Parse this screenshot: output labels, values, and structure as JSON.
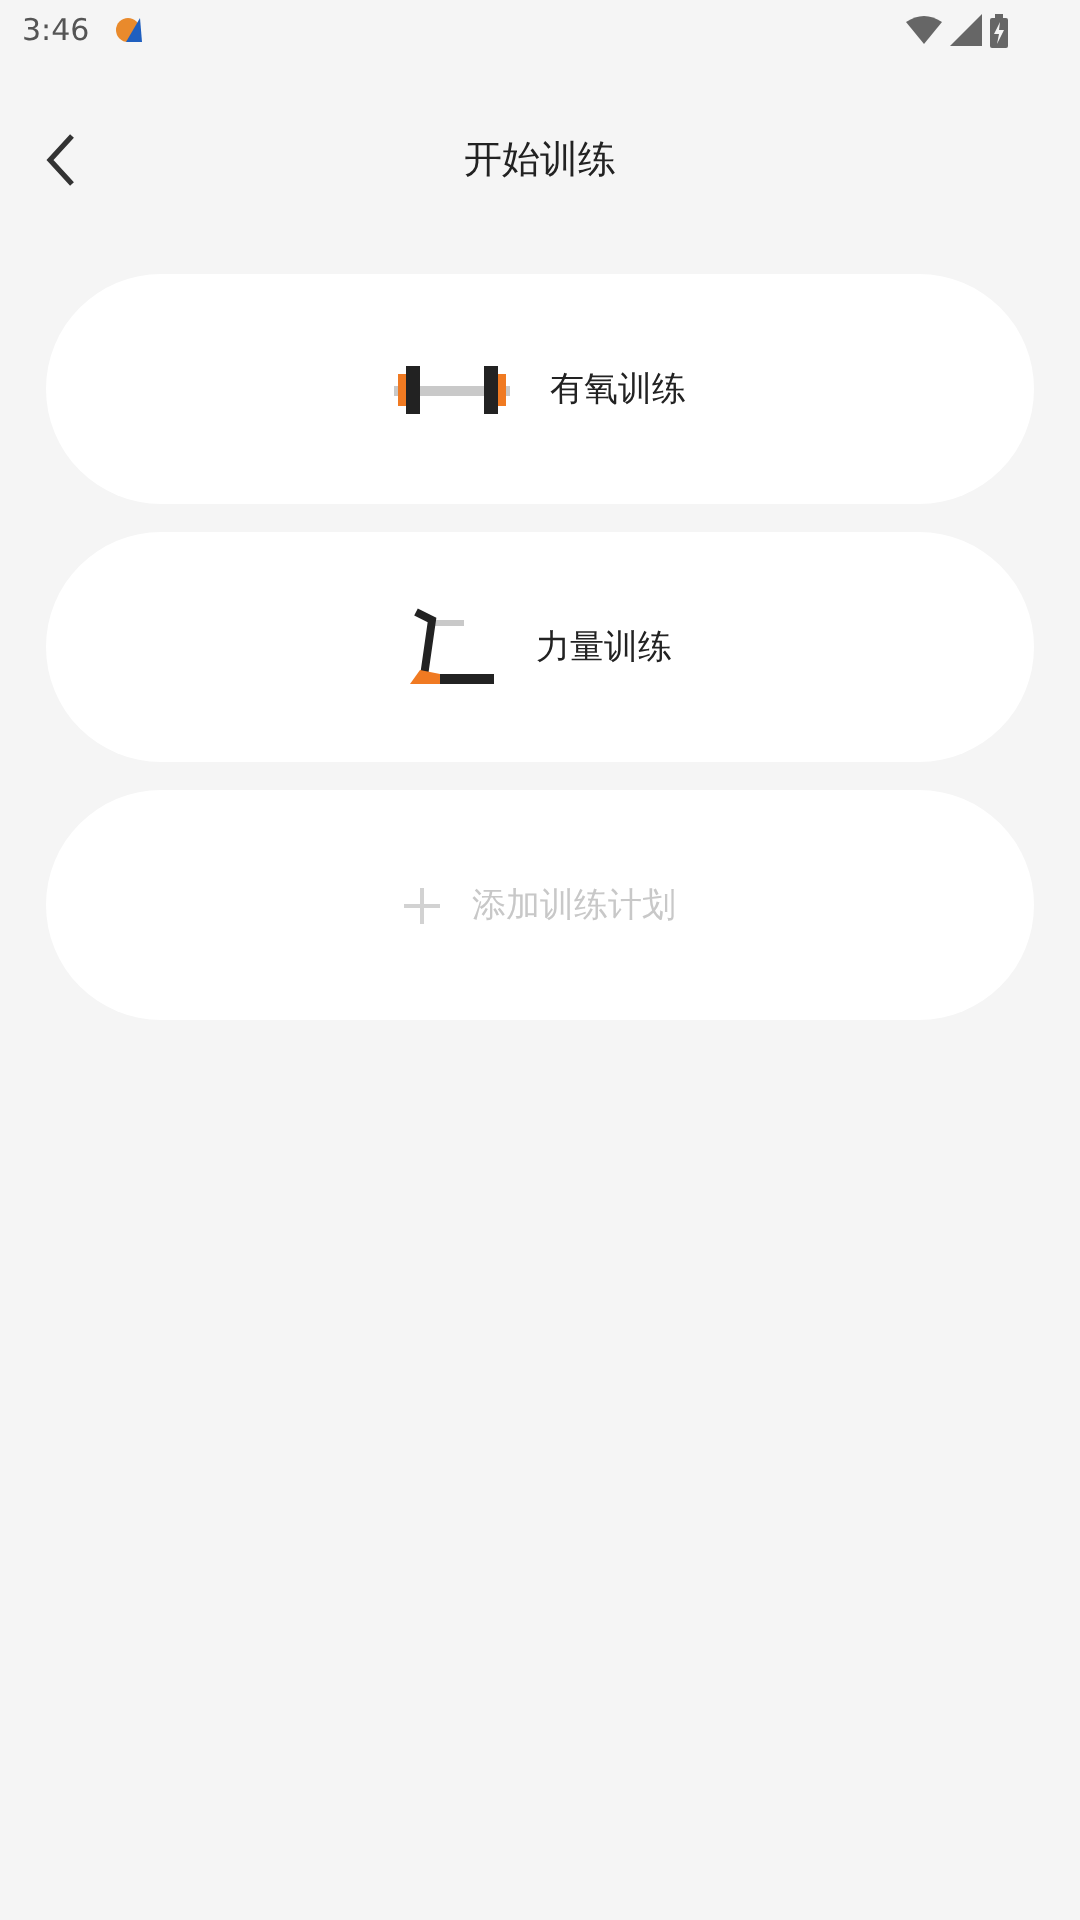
{
  "status_bar": {
    "time": "3:46"
  },
  "header": {
    "title": "开始训练"
  },
  "items": [
    {
      "kind": "dumbbell",
      "label": "有氧训练"
    },
    {
      "kind": "treadmill",
      "label": "力量训练"
    },
    {
      "kind": "add",
      "label": "添加训练计划"
    }
  ]
}
